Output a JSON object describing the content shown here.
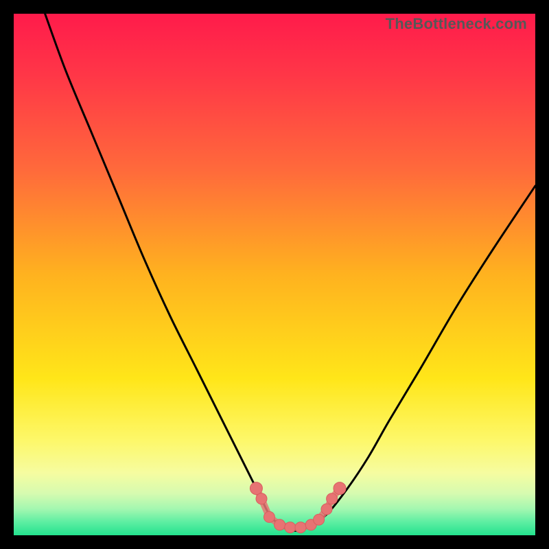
{
  "watermark": "TheBottleneck.com",
  "colors": {
    "frame": "#000000",
    "curve_stroke": "#000000",
    "marker_fill": "#e77373",
    "marker_stroke": "#d85f5f",
    "gradient_stops": [
      {
        "offset": 0.0,
        "color": "#ff1b4b"
      },
      {
        "offset": 0.12,
        "color": "#ff3747"
      },
      {
        "offset": 0.3,
        "color": "#ff6a3b"
      },
      {
        "offset": 0.5,
        "color": "#ffb21f"
      },
      {
        "offset": 0.7,
        "color": "#ffe619"
      },
      {
        "offset": 0.82,
        "color": "#fdf86b"
      },
      {
        "offset": 0.88,
        "color": "#f6fca0"
      },
      {
        "offset": 0.92,
        "color": "#d6fbb0"
      },
      {
        "offset": 0.95,
        "color": "#a2f7b0"
      },
      {
        "offset": 0.975,
        "color": "#5ceea2"
      },
      {
        "offset": 1.0,
        "color": "#23e28e"
      }
    ]
  },
  "chart_data": {
    "type": "line",
    "title": "",
    "xlabel": "",
    "ylabel": "",
    "xlim": [
      0,
      100
    ],
    "ylim": [
      0,
      100
    ],
    "series": [
      {
        "name": "bottleneck-curve",
        "x": [
          6,
          10,
          15,
          20,
          25,
          30,
          35,
          40,
          44,
          47,
          49,
          51,
          53,
          55,
          57,
          60,
          64,
          68,
          72,
          78,
          85,
          92,
          100
        ],
        "y": [
          100,
          89,
          77,
          65,
          53,
          42,
          32,
          22,
          14,
          8,
          4,
          2,
          1,
          1,
          2,
          4,
          9,
          15,
          22,
          32,
          44,
          55,
          67
        ]
      }
    ],
    "markers": {
      "name": "highlight-points",
      "x": [
        46.5,
        47.5,
        49,
        51,
        53,
        55,
        57,
        58.5,
        60,
        61,
        62.5
      ],
      "y": [
        9,
        7,
        3.5,
        2,
        1.5,
        1.5,
        2,
        3,
        5,
        7,
        9
      ]
    }
  }
}
